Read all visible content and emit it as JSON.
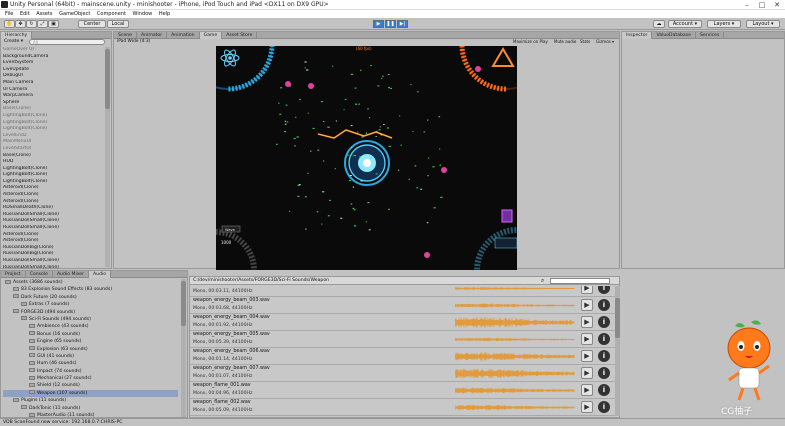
{
  "window": {
    "title": "Unity Personal (64bit) - mainscene.unity - minishooter - iPhone, iPod Touch and iPad <DX11 on DX9 GPU>",
    "min": "–",
    "max": "□",
    "close": "✕"
  },
  "menu": [
    "File",
    "Edit",
    "Assets",
    "GameObject",
    "Component",
    "Window",
    "Help"
  ],
  "toolbar": {
    "pivot": "Center",
    "space": "Local",
    "play": "▶",
    "pause": "❚❚",
    "step": "▶|",
    "cloud": "☁",
    "account": "Account ▾",
    "layers": "Layers ▾",
    "layout": "Layout ▾"
  },
  "hierarchy": {
    "tab": "Hierarchy",
    "create": "Create ▾",
    "search_placeholder": "All",
    "items": [
      {
        "label": "GameOver UI",
        "gray": true
      },
      {
        "label": "BackgroundCamera",
        "gray": false
      },
      {
        "label": "EventSystem",
        "gray": false
      },
      {
        "label": "LiveUpdate",
        "gray": false
      },
      {
        "label": "DebugUI",
        "gray": false
      },
      {
        "label": "Main Camera",
        "gray": false
      },
      {
        "label": "UI Camera",
        "gray": false
      },
      {
        "label": "WarpCamera",
        "gray": false
      },
      {
        "label": "Sphere",
        "gray": false
      },
      {
        "label": "Base(Clone)",
        "gray": true
      },
      {
        "label": "LightingBolt(Clone)",
        "gray": true
      },
      {
        "label": "LightingBolt(Clone)",
        "gray": true
      },
      {
        "label": "LightingBolt(Clone)",
        "gray": true
      },
      {
        "label": "LevelEnd2",
        "gray": true
      },
      {
        "label": "MainMenuUI",
        "gray": true
      },
      {
        "label": "LevelStartUI",
        "gray": true
      },
      {
        "label": "Base(Clone)",
        "gray": false
      },
      {
        "label": "HUD",
        "gray": false
      },
      {
        "label": "LightingBolt(Clone)",
        "gray": false
      },
      {
        "label": "LightingBolt(Clone)",
        "gray": false
      },
      {
        "label": "LightingBolt(Clone)",
        "gray": false
      },
      {
        "label": "Asteroid(Clone)",
        "gray": false
      },
      {
        "label": "Asteroid(Clone)",
        "gray": false
      },
      {
        "label": "Asteroid(Clone)",
        "gray": false
      },
      {
        "label": "RDSmallDeath(Clone)",
        "gray": false
      },
      {
        "label": "RussianDollSmall(Clone)",
        "gray": false
      },
      {
        "label": "RussianDollSmall(Clone)",
        "gray": false
      },
      {
        "label": "RussianDollSmall(Clone)",
        "gray": false
      },
      {
        "label": "Asteroid(Clone)",
        "gray": false
      },
      {
        "label": "Asteroid(Clone)",
        "gray": false
      },
      {
        "label": "RussianDollBig(Clone)",
        "gray": false
      },
      {
        "label": "RussianDollBig(Clone)",
        "gray": false
      },
      {
        "label": "RussianDollSmall(Clone)",
        "gray": false
      },
      {
        "label": "RussianDollSmall(Clone)",
        "gray": false
      },
      {
        "label": "RussianDollSmall(Clone)",
        "gray": false
      }
    ]
  },
  "scene_tabs": [
    "Scene",
    "Animator",
    "Animation",
    "Game",
    "Asset Store"
  ],
  "game": {
    "aspect": "iPad Wide (4:3)",
    "options": [
      "Maximize on Play",
      "Mute audio",
      "Stats",
      "Gizmos ▾"
    ],
    "hud_fps": "(60 fps)",
    "hud_wave": "Wave",
    "hud_score": "1000"
  },
  "inspector": {
    "tabs": [
      "Inspector",
      "ValueDatabase",
      "Services"
    ]
  },
  "project": {
    "tabs": [
      "Project",
      "Console",
      "Audio Mixer",
      "Audio"
    ],
    "create": "Create ▾",
    "tree": [
      {
        "label": "Assets (3686 sounds)",
        "indent": 0,
        "sel": false
      },
      {
        "label": "83 Explosion Sound Effects (83 sounds)",
        "indent": 1,
        "sel": false
      },
      {
        "label": "Dark Future (20 sounds)",
        "indent": 1,
        "sel": false
      },
      {
        "label": "Extras (7 sounds)",
        "indent": 2,
        "sel": false
      },
      {
        "label": "FORGE3D (494 sounds)",
        "indent": 1,
        "sel": false
      },
      {
        "label": "Sci-Fi Sounds (494 sounds)",
        "indent": 2,
        "sel": false
      },
      {
        "label": "Ambience (43 sounds)",
        "indent": 3,
        "sel": false
      },
      {
        "label": "Bonus (16 sounds)",
        "indent": 3,
        "sel": false
      },
      {
        "label": "Engine (65 sounds)",
        "indent": 3,
        "sel": false
      },
      {
        "label": "Explosion (63 sounds)",
        "indent": 3,
        "sel": false
      },
      {
        "label": "GUI (41 sounds)",
        "indent": 3,
        "sel": false
      },
      {
        "label": "Hum (46 sounds)",
        "indent": 3,
        "sel": false
      },
      {
        "label": "Impact (74 sounds)",
        "indent": 3,
        "sel": false
      },
      {
        "label": "Mechanical (27 sounds)",
        "indent": 3,
        "sel": false
      },
      {
        "label": "Shield (12 sounds)",
        "indent": 3,
        "sel": false
      },
      {
        "label": "Weapon (107 sounds)",
        "indent": 3,
        "sel": true
      },
      {
        "label": "Plugins (11 sounds)",
        "indent": 1,
        "sel": false
      },
      {
        "label": "DarkTonic (11 sounds)",
        "indent": 2,
        "sel": false
      },
      {
        "label": "MasterAudio (11 sounds)",
        "indent": 3,
        "sel": false
      }
    ]
  },
  "audio": {
    "path": "C:/dev/minishooter/Assets/FORGE3D/Sci-Fi Sounds/Weapon",
    "search_placeholder": "",
    "rows": [
      {
        "name": "",
        "info": "Mono, 00:03.11, 44100Hz",
        "amp": 0.25
      },
      {
        "name": "weapon_energy_beam_003.wav",
        "info": "Mono, 00:03.68, 44100Hz",
        "amp": 0.35
      },
      {
        "name": "weapon_energy_beam_004.wav",
        "info": "Mono, 00:01.92, 44100Hz",
        "amp": 0.9
      },
      {
        "name": "weapon_energy_beam_005.wav",
        "info": "Mono, 00:05.39, 44100Hz",
        "amp": 0.3
      },
      {
        "name": "weapon_energy_beam_006.wav",
        "info": "Mono, 00:01.14, 44100Hz",
        "amp": 0.7
      },
      {
        "name": "weapon_energy_beam_007.wav",
        "info": "Mono, 00:01.07, 44100Hz",
        "amp": 0.8
      },
      {
        "name": "weapon_flame_001.wav",
        "info": "Mono, 00:04.96, 44100Hz",
        "amp": 0.5
      },
      {
        "name": "weapon_flame_002.wav",
        "info": "Mono, 00:05.09, 44100Hz",
        "amp": 0.45
      }
    ]
  },
  "status": {
    "text": "VDB ScanFound new service: 192.168.0.7:CHRIS-PC"
  },
  "watermark": "CG柚子",
  "colors": {
    "waveform": "#e8901a",
    "game_ring": "#2aa8e0",
    "laser": "#ff8a20",
    "hud_orange": "#ff6a1a",
    "hud_purple": "#c040e0",
    "particle": "#40e060",
    "enemy": "#e040a0"
  }
}
